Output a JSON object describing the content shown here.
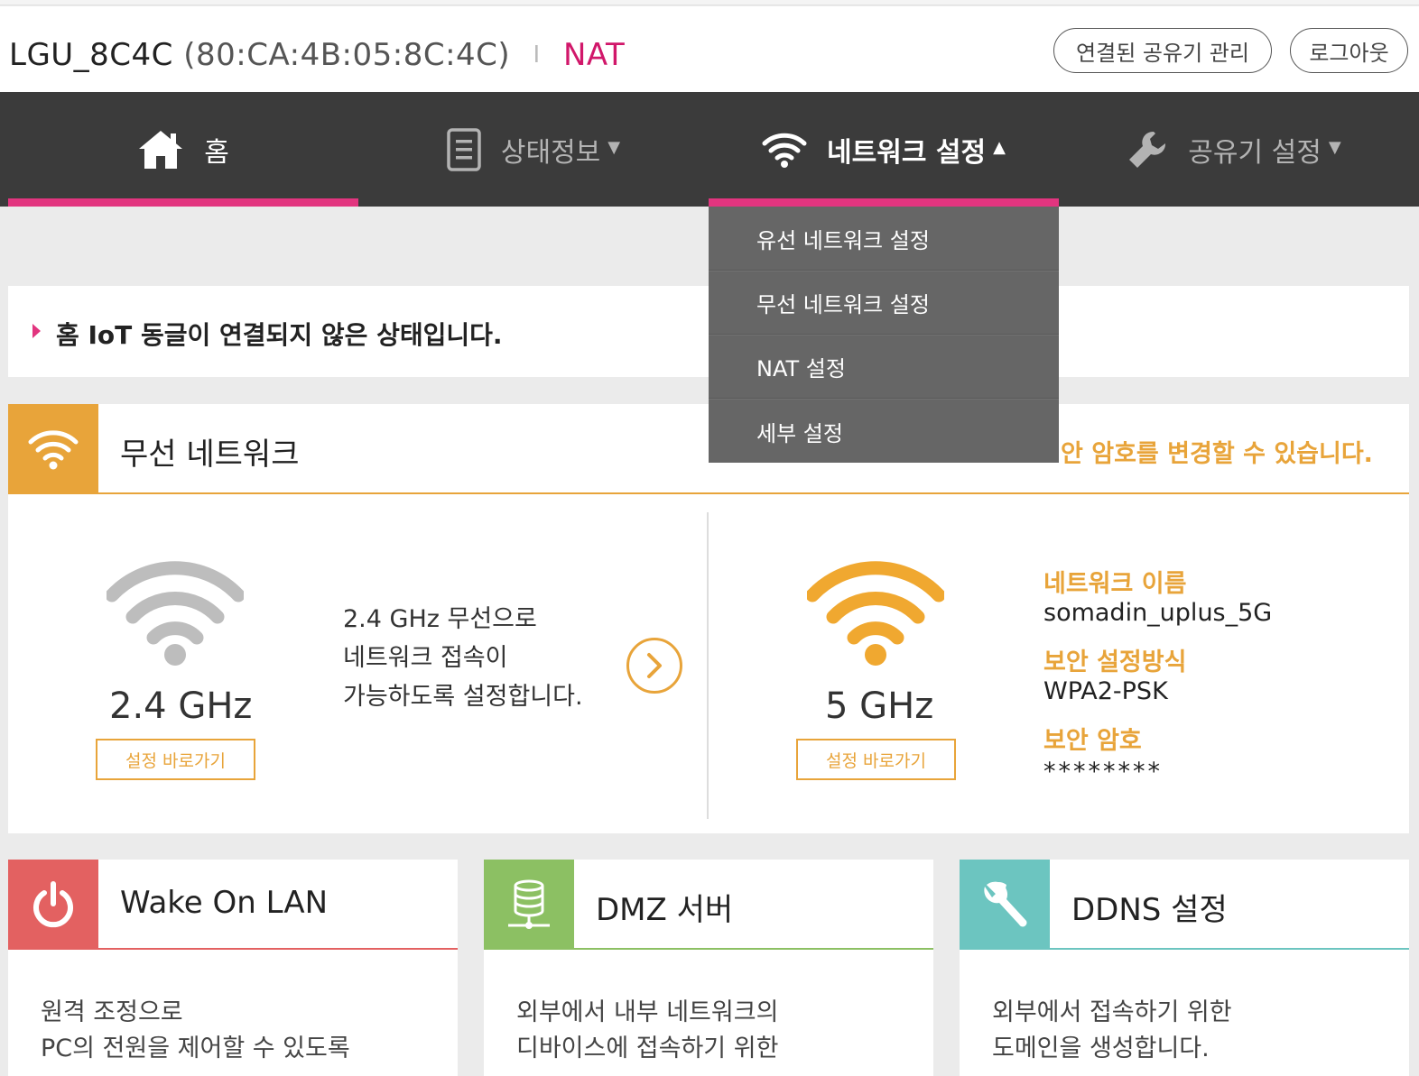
{
  "header": {
    "device_name": "LGU_8C4C",
    "device_mac": "(80:CA:4B:05:8C:4C)",
    "separator": "I",
    "mode": "NAT",
    "manage_button": "연결된 공유기 관리",
    "logout_button": "로그아웃"
  },
  "nav": {
    "items": [
      {
        "label": "홈",
        "icon": "home-icon",
        "active": true
      },
      {
        "label": "상태정보",
        "icon": "document-icon",
        "caret": "▼"
      },
      {
        "label": "네트워크 설정",
        "icon": "wifi-icon",
        "caret": "▲",
        "active": true
      },
      {
        "label": "공유기 설정",
        "icon": "wrench-icon",
        "caret": "▼"
      }
    ],
    "accent": "#e2357f"
  },
  "dropdown": {
    "items": [
      "유선 네트워크 설정",
      "무선 네트워크 설정",
      "NAT 설정",
      "세부 설정"
    ]
  },
  "notice": {
    "text": "홈 IoT 동글이 연결되지 않은 상태입니다."
  },
  "wireless": {
    "title": "무선 네트워크",
    "hint": "안 암호를 변경할 수 있습니다.",
    "color": "#e8a43a",
    "band24": {
      "label": "2.4 GHz",
      "button": "설정 바로가기",
      "desc": [
        "2.4 GHz 무선으로",
        "네트워크 접속이",
        "가능하도록 설정합니다."
      ]
    },
    "band5": {
      "label": "5 GHz",
      "button": "설정 바로가기",
      "network_name_label": "네트워크 이름",
      "network_name": "somadin_uplus_5G",
      "security_label": "보안 설정방식",
      "security": "WPA2-PSK",
      "password_label": "보안 암호",
      "password": "********"
    }
  },
  "cards": [
    {
      "title": "Wake On LAN",
      "color": "#e36161",
      "icon": "power-icon",
      "desc": [
        "원격 조정으로",
        "PC의 전원을 제어할 수 있도록"
      ]
    },
    {
      "title": "DMZ 서버",
      "color": "#8cc063",
      "icon": "server-icon",
      "desc": [
        "외부에서 내부 네트워크의",
        "디바이스에 접속하기 위한"
      ]
    },
    {
      "title": "DDNS 설정",
      "color": "#6cc5c0",
      "icon": "wrench-icon",
      "desc": [
        "외부에서 접속하기 위한",
        "도메인을 생성합니다."
      ]
    }
  ]
}
